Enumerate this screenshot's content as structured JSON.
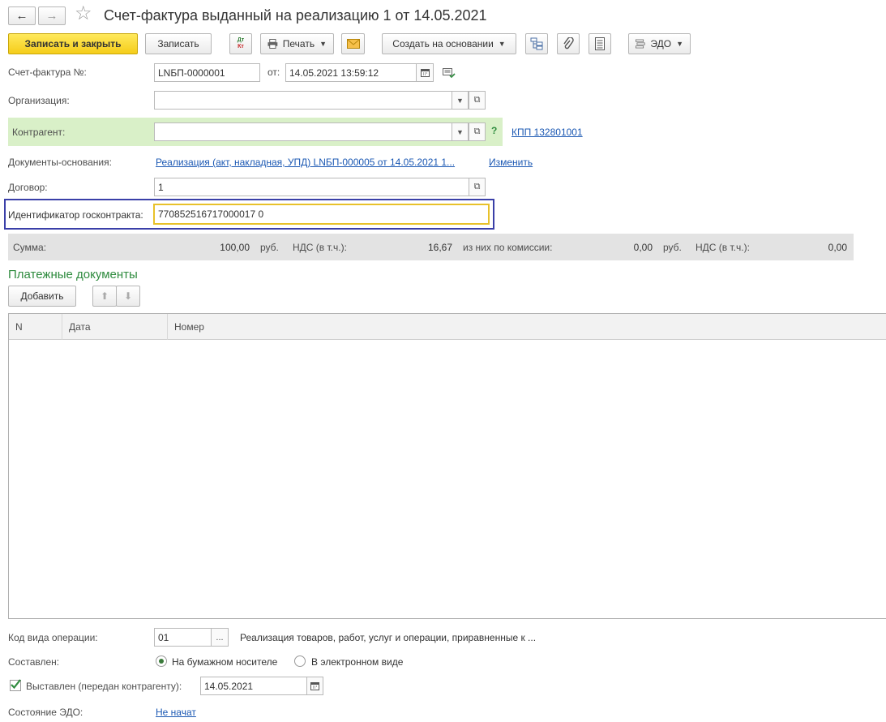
{
  "window": {
    "title": "Счет-фактура выданный на реализацию 1 от 14.05.2021",
    "back_glyph": "←",
    "forward_glyph": "→",
    "favorite_glyph": "☆"
  },
  "toolbar": {
    "save_close_label": "Записать и закрыть",
    "save_label": "Записать",
    "dtkt_top": "Дт",
    "dtkt_bottom": "Кт",
    "print_label": "Печать",
    "create_based_label": "Создать на основании",
    "edo_label": "ЭДО"
  },
  "form": {
    "invoice_no_label": "Счет-фактура №:",
    "invoice_no_value": "LNБП-0000001",
    "from_label": "от:",
    "date_value": "14.05.2021 13:59:12",
    "organization_label": "Организация:",
    "organization_value": "",
    "counterparty_label": "Контрагент:",
    "counterparty_value": "",
    "help_glyph": "?",
    "kpp_link": "КПП 132801001",
    "base_docs_label": "Документы-основания:",
    "base_docs_link": "Реализация (акт, накладная, УПД) LNБП-000005 от 14.05.2021 1...",
    "change_link": "Изменить",
    "contract_label": "Договор:",
    "contract_value": "1",
    "gov_contract_label": "Идентификатор госконтракта:",
    "gov_contract_value": "770852516717000017 0"
  },
  "summary": {
    "sum_label": "Сумма:",
    "sum_value": "100,00",
    "currency1": "руб.",
    "vat_label": "НДС (в т.ч.):",
    "vat_value": "16,67",
    "commission_label": "из них по комиссии:",
    "commission_value": "0,00",
    "currency2": "руб.",
    "vat2_label": "НДС (в т.ч.):",
    "vat2_value": "0,00"
  },
  "payments": {
    "title": "Платежные документы",
    "add_label": "Добавить",
    "columns": [
      "N",
      "Дата",
      "Номер"
    ],
    "rows": []
  },
  "footer": {
    "op_code_label": "Код вида операции:",
    "op_code_value": "01",
    "op_code_desc": "Реализация товаров, работ, услуг и операции, приравненные к ...",
    "compiled_label": "Составлен:",
    "paper_label": "На бумажном носителе",
    "electronic_label": "В электронном виде",
    "issued_label": "Выставлен (передан контрагенту):",
    "issued_date": "14.05.2021",
    "edo_state_label": "Состояние ЭДО:",
    "edo_state_link": "Не начат"
  },
  "colors": {
    "primary_button": "#f5cd1a",
    "counterparty_highlight": "#d9f0c8",
    "focus_border": "#3a3fa8",
    "input_focus": "#e8c12a",
    "section_title": "#2e8b3e",
    "link": "#1b58b3"
  }
}
